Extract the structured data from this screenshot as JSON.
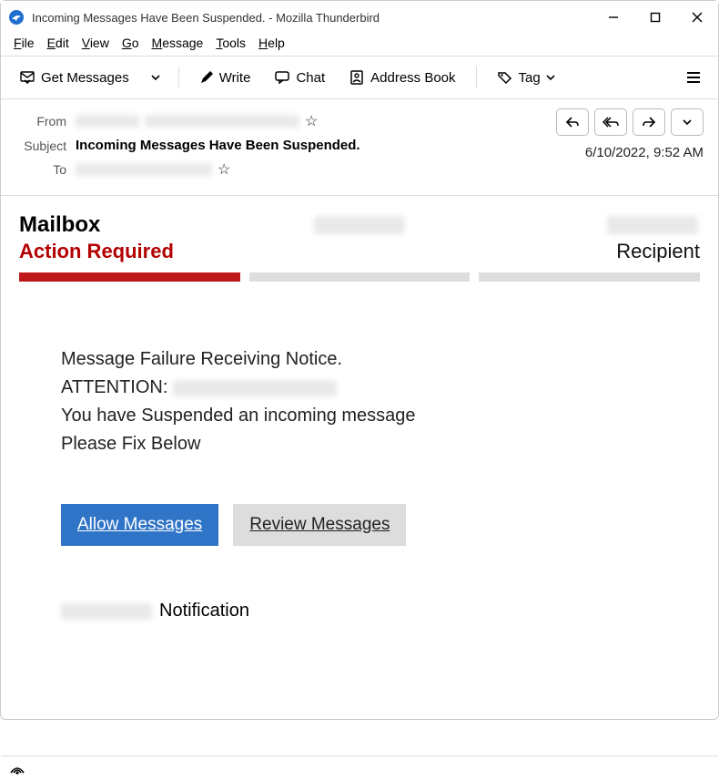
{
  "window": {
    "title": "Incoming Messages Have Been Suspended. - Mozilla Thunderbird"
  },
  "menubar": [
    "File",
    "Edit",
    "View",
    "Go",
    "Message",
    "Tools",
    "Help"
  ],
  "toolbar": {
    "get_messages": "Get Messages",
    "write": "Write",
    "chat": "Chat",
    "address_book": "Address Book",
    "tag": "Tag"
  },
  "header": {
    "from_label": "From",
    "subject_label": "Subject",
    "to_label": "To",
    "subject_value": "Incoming Messages Have Been Suspended.",
    "date": "6/10/2022, 9:52 AM"
  },
  "body": {
    "mailbox_title": "Mailbox",
    "action_required": "Action Required",
    "recipient_label": "Recipient",
    "line1": "Message Failure Receiving Notice.",
    "attention_prefix": "ATTENTION:",
    "line3": "You have Suspended an incoming message",
    "line4": "Please Fix Below",
    "allow_btn": "Allow Messages",
    "review_btn": "Review Messages",
    "notification": "Notification"
  }
}
